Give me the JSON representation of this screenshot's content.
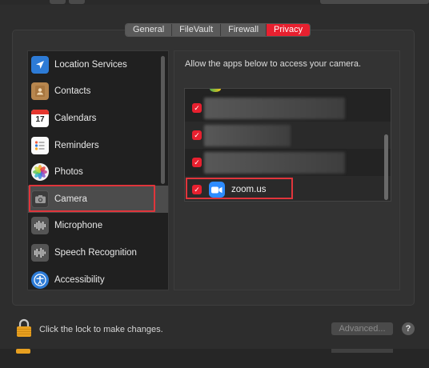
{
  "tabs": [
    {
      "label": "General",
      "active": false
    },
    {
      "label": "FileVault",
      "active": false
    },
    {
      "label": "Firewall",
      "active": false
    },
    {
      "label": "Privacy",
      "active": true
    }
  ],
  "sidebar": {
    "items": [
      {
        "label": "Location Services",
        "icon": "location-arrow-icon"
      },
      {
        "label": "Contacts",
        "icon": "contacts-book-icon"
      },
      {
        "label": "Calendars",
        "icon": "calendar-icon",
        "icon_text": "17"
      },
      {
        "label": "Reminders",
        "icon": "reminders-list-icon"
      },
      {
        "label": "Photos",
        "icon": "photos-flower-icon"
      },
      {
        "label": "Camera",
        "icon": "camera-icon",
        "selected": true
      },
      {
        "label": "Microphone",
        "icon": "microphone-waveform-icon"
      },
      {
        "label": "Speech Recognition",
        "icon": "speech-waveform-icon"
      },
      {
        "label": "Accessibility",
        "icon": "accessibility-icon"
      }
    ]
  },
  "main": {
    "description": "Allow the apps below to access your camera.",
    "apps": [
      {
        "name": "",
        "checked": true,
        "blurred": true
      },
      {
        "name": "",
        "checked": true,
        "blurred": true
      },
      {
        "name": "",
        "checked": true,
        "blurred": true
      },
      {
        "name": "zoom.us",
        "checked": true,
        "icon": "zoom-video-icon"
      }
    ]
  },
  "footer": {
    "lock_text": "Click the lock to make changes.",
    "advanced_label": "Advanced...",
    "help_label": "?"
  },
  "colors": {
    "accent": "#e8202f",
    "highlight_border": "#e0353b",
    "zoom_blue": "#2d8cff",
    "lock": "#e8a020"
  }
}
